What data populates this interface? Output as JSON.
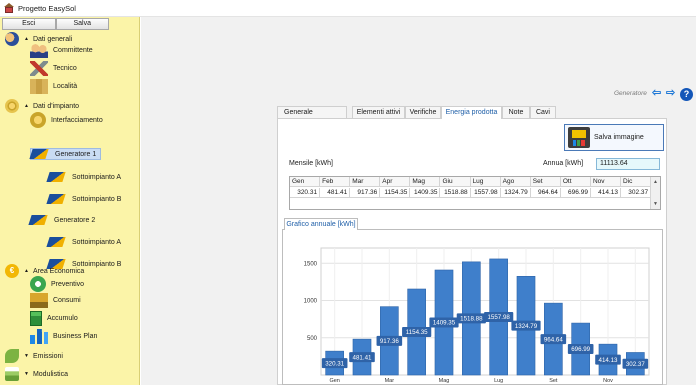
{
  "window": {
    "title": "Progetto EasySol"
  },
  "sidebar": {
    "buttons": {
      "esci": "Esci",
      "salva": "Salva"
    },
    "groups": {
      "dati_generali": "Dati generali",
      "dati_impianto": "Dati d'impianto",
      "area_economica": "Area Economica",
      "emissioni": "Emissioni",
      "modulistica": "Modulistica"
    },
    "items": {
      "committente": "Committente",
      "tecnico": "Tecnico",
      "localita": "Località",
      "interfacciamento": "Interfacciamento",
      "generatore1": "Generatore 1",
      "sottoimpianto_a1": "Sottoimpianto A",
      "sottoimpianto_b1": "Sottoimpianto B",
      "generatore2": "Generatore 2",
      "sottoimpianto_a2": "Sottoimpianto A",
      "sottoimpianto_b2": "Sottoimpianto B",
      "preventivo": "Preventivo",
      "consumi": "Consumi",
      "accumulo": "Accumulo",
      "business_plan": "Business Plan"
    }
  },
  "header": {
    "generatore": "Generatore"
  },
  "tabs": {
    "generale": "Generale",
    "elementi_attivi": "Elementi attivi",
    "verifiche": "Verifiche",
    "energia_prodotta": "Energia prodotta",
    "note": "Note",
    "cavi": "Cavi"
  },
  "energy": {
    "save_image": "Salva immagine",
    "mensile_label": "Mensile [kWh]",
    "annua_label": "Annua [kWh]",
    "annua_value": "11113.64",
    "months": [
      "Gen",
      "Feb",
      "Mar",
      "Apr",
      "Mag",
      "Giu",
      "Lug",
      "Ago",
      "Set",
      "Ott",
      "Nov",
      "Dic"
    ],
    "values": [
      "320.31",
      "481.41",
      "917.36",
      "1154.35",
      "1409.35",
      "1518.88",
      "1557.98",
      "1324.79",
      "964.64",
      "696.99",
      "414.13",
      "302.37"
    ],
    "chart_tab": "Grafico annuale [kWh]"
  },
  "chart_data": {
    "type": "bar",
    "categories": [
      "Gen",
      "Feb",
      "Mar",
      "Apr",
      "Mag",
      "Giu",
      "Lug",
      "Ago",
      "Set",
      "Ott",
      "Nov",
      "Dic"
    ],
    "values": [
      320.31,
      481.41,
      917.36,
      1154.35,
      1409.35,
      1518.88,
      1557.98,
      1324.79,
      964.64,
      696.99,
      414.13,
      302.37
    ],
    "x_tick_labels": [
      "Gen",
      "Mar",
      "Mag",
      "Lug",
      "Set",
      "Nov"
    ],
    "y_ticks": [
      500,
      1000,
      1500
    ],
    "title": "",
    "xlabel": "",
    "ylabel": "",
    "grid": true,
    "colors": {
      "bar": "#3f7fcb",
      "bar_edge": "#2e64a8",
      "label_bg": "#2f63a8",
      "label_text": "#ffffff"
    }
  }
}
